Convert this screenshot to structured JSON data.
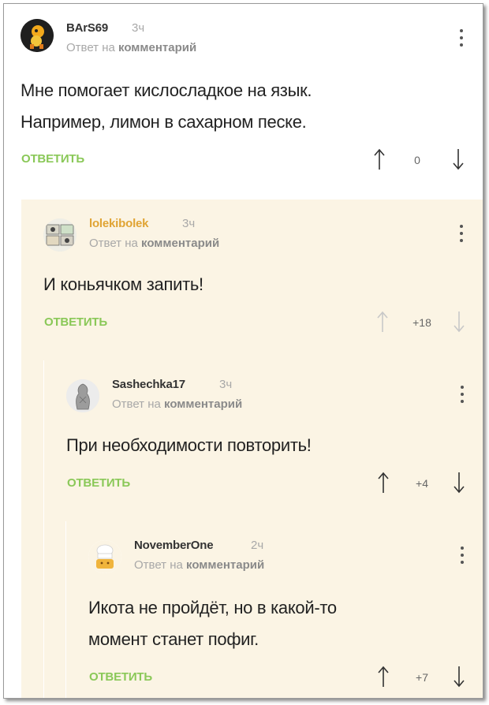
{
  "comments": [
    {
      "username": "BArS69",
      "time": "3ч",
      "reply_prefix": "Ответ на",
      "reply_target": "комментарий",
      "lines": [
        "Мне помогает кислосладкое на язык.",
        "Например, лимон в сахарном песке."
      ],
      "reply_label": "ОТВЕТИТЬ",
      "score": "0",
      "avatar_icon": "cartoon-character-avatar"
    },
    {
      "username": "lolekibolek",
      "time": "3ч",
      "reply_prefix": "Ответ на",
      "reply_target": "комментарий",
      "lines": [
        "И коньячком запить!"
      ],
      "reply_label": "ОТВЕТИТЬ",
      "score": "+18",
      "avatar_icon": "comic-strip-avatar"
    },
    {
      "username": "Sashechka17",
      "time": "3ч",
      "reply_prefix": "Ответ на",
      "reply_target": "комментарий",
      "lines": [
        "При необходимости повторить!"
      ],
      "reply_label": "ОТВЕТИТЬ",
      "score": "+4",
      "avatar_icon": "statue-avatar"
    },
    {
      "username": "NovemberOne",
      "time": "2ч",
      "reply_prefix": "Ответ на",
      "reply_target": "комментарий",
      "lines": [
        "Икота не пройдёт, но в какой-то",
        "момент станет пофиг."
      ],
      "reply_label": "ОТВЕТИТЬ",
      "score": "+7",
      "avatar_icon": "chef-avatar"
    }
  ],
  "colors": {
    "reply_green": "#8ac858",
    "username_orange": "#e0a434",
    "nested_bg": "#fbf4e4",
    "muted_text": "#a8a8a8"
  }
}
